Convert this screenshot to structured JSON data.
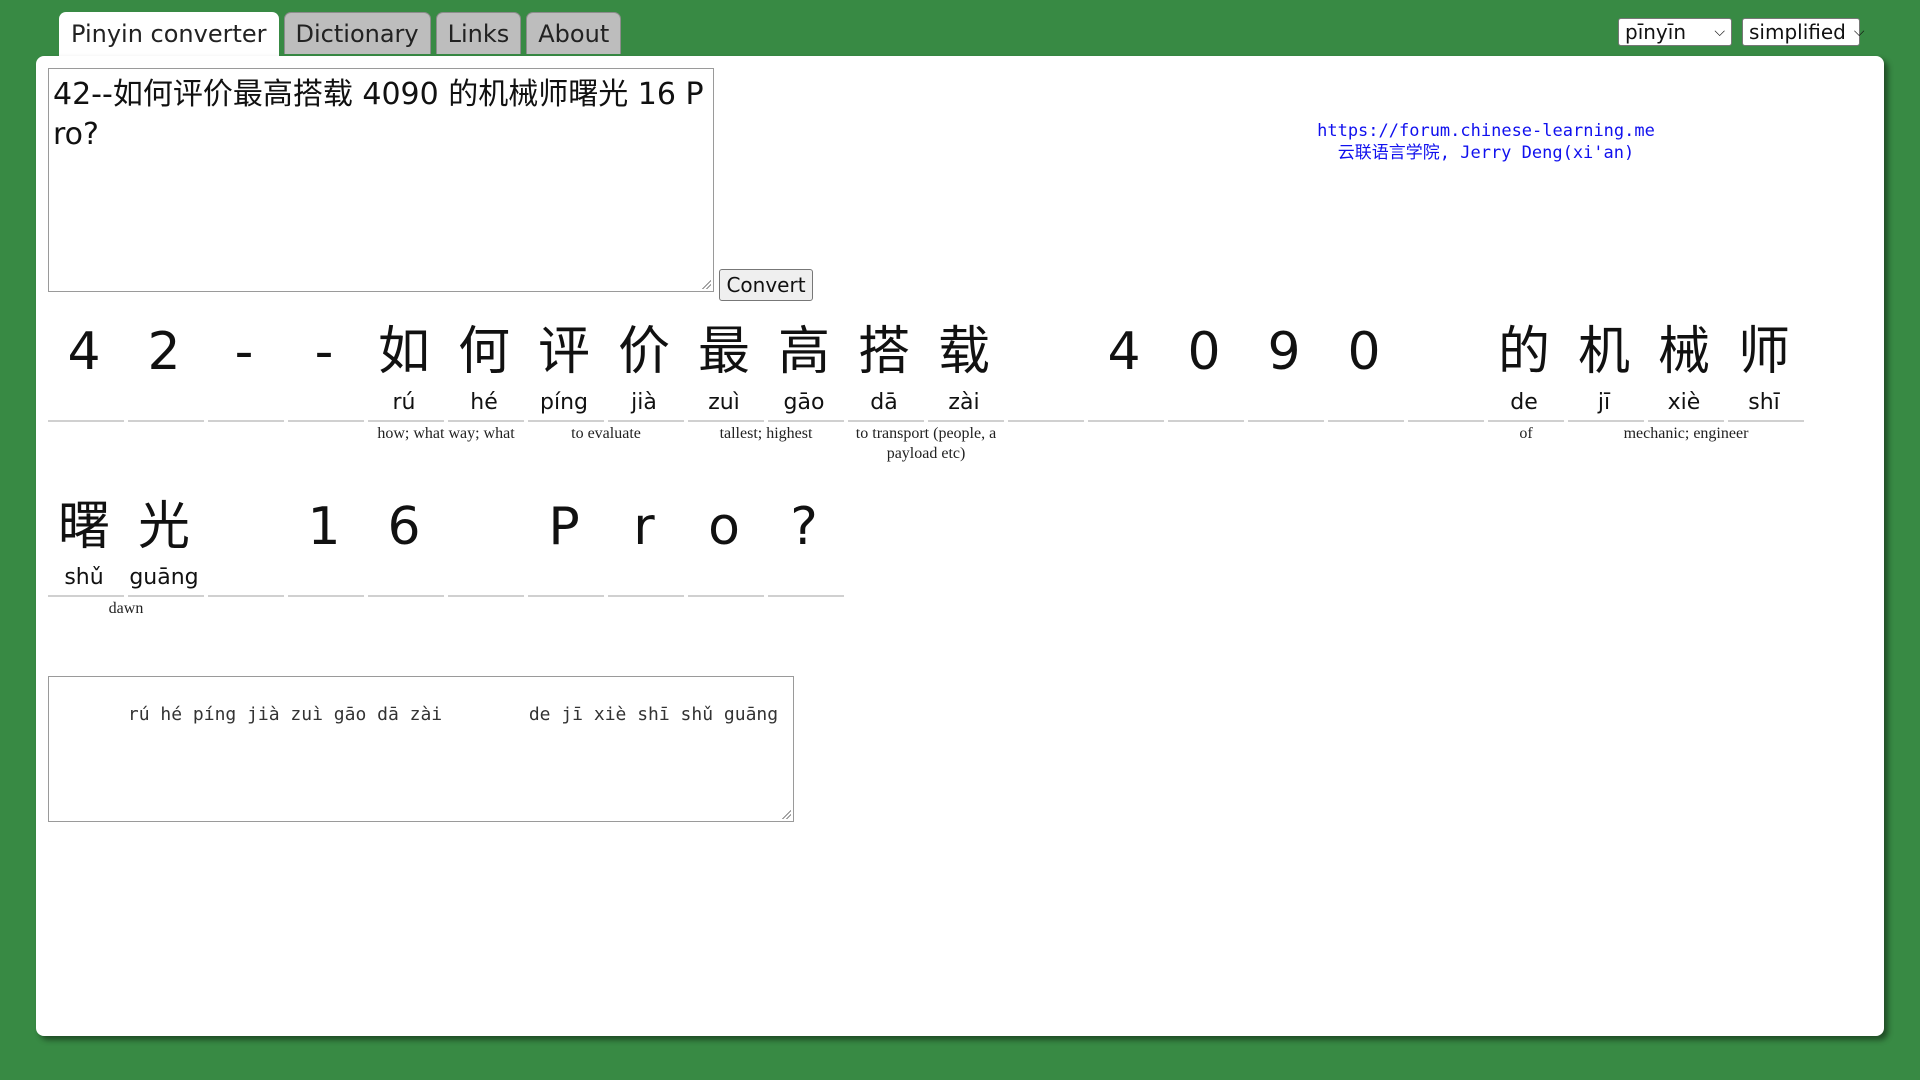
{
  "tabs": [
    {
      "label": "Pinyin converter",
      "active": true
    },
    {
      "label": "Dictionary",
      "active": false
    },
    {
      "label": "Links",
      "active": false
    },
    {
      "label": "About",
      "active": false
    }
  ],
  "selects": {
    "mode": "pīnyīn",
    "script": "simplified"
  },
  "input": {
    "value": "42--如何评价最高搭载 4090 的机械师曙光 16 Pro?"
  },
  "convert_label": "Convert",
  "credits": {
    "line1": "https://forum.chinese-learning.me",
    "line2": "云联语言学院, Jerry Deng(xi'an)"
  },
  "row1": {
    "cells": [
      {
        "hz": "4",
        "py": ""
      },
      {
        "hz": "2",
        "py": ""
      },
      {
        "hz": "-",
        "py": ""
      },
      {
        "hz": "-",
        "py": ""
      },
      {
        "hz": "如",
        "py": "rú"
      },
      {
        "hz": "何",
        "py": "hé"
      },
      {
        "hz": "评",
        "py": "píng"
      },
      {
        "hz": "价",
        "py": "jià"
      },
      {
        "hz": "最",
        "py": "zuì"
      },
      {
        "hz": "高",
        "py": "gāo"
      },
      {
        "hz": "搭",
        "py": "dā"
      },
      {
        "hz": "载",
        "py": "zài"
      },
      {
        "hz": "",
        "py": ""
      },
      {
        "hz": "4",
        "py": ""
      },
      {
        "hz": "0",
        "py": ""
      },
      {
        "hz": "9",
        "py": ""
      },
      {
        "hz": "0",
        "py": ""
      },
      {
        "hz": "",
        "py": ""
      },
      {
        "hz": "的",
        "py": "de"
      },
      {
        "hz": "机",
        "py": "jī"
      },
      {
        "hz": "械",
        "py": "xiè"
      },
      {
        "hz": "师",
        "py": "shī"
      }
    ],
    "glosses": [
      {
        "text": "how; what way; what",
        "from": 4,
        "to": 5
      },
      {
        "text": "to evaluate",
        "from": 6,
        "to": 7
      },
      {
        "text": "tallest; highest",
        "from": 8,
        "to": 9
      },
      {
        "text": "to transport (people, a payload etc)",
        "from": 10,
        "to": 11
      },
      {
        "text": "of",
        "from": 18,
        "to": 18
      },
      {
        "text": "mechanic; engineer",
        "from": 19,
        "to": 21
      }
    ]
  },
  "row2": {
    "cells": [
      {
        "hz": "曙",
        "py": "shǔ"
      },
      {
        "hz": "光",
        "py": "guāng"
      },
      {
        "hz": "",
        "py": ""
      },
      {
        "hz": "1",
        "py": ""
      },
      {
        "hz": "6",
        "py": ""
      },
      {
        "hz": "",
        "py": ""
      },
      {
        "hz": "P",
        "py": ""
      },
      {
        "hz": "r",
        "py": ""
      },
      {
        "hz": "o",
        "py": ""
      },
      {
        "hz": "?",
        "py": ""
      }
    ],
    "glosses": [
      {
        "text": "dawn",
        "from": 0,
        "to": 1
      }
    ]
  },
  "output": {
    "value": "   rú hé píng jià zuì gāo dā zài        de jī xiè shī shǔ guāng"
  }
}
